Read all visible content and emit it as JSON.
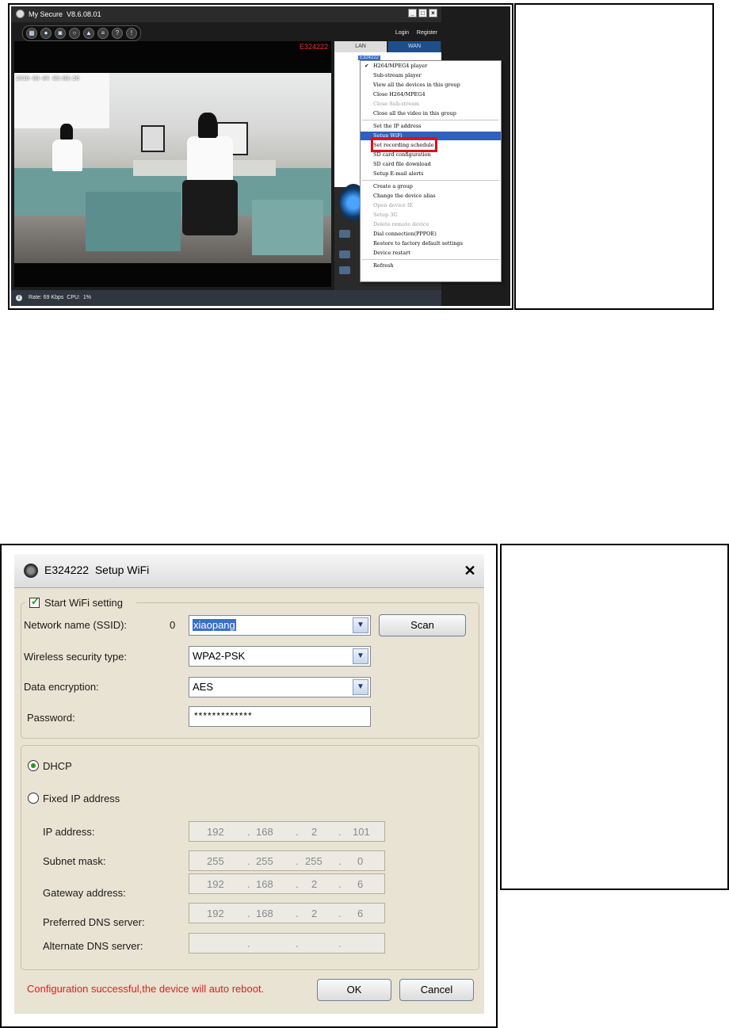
{
  "app": {
    "title": "My Secure",
    "version": "V8.6.08.01",
    "login_label": "Login",
    "register_label": "Register",
    "device_id": "E324222",
    "timestamp": "2016-08-04 09:08:26",
    "tabs": {
      "lan": "LAN",
      "wan": "WAN"
    },
    "tree_node": "E324222",
    "status": {
      "rate": "Rate: 69 Kbps",
      "cpu": "CPU:",
      "cpu_value": "1%"
    },
    "toolbar_icons": [
      "layout-icon",
      "record-icon",
      "camera-icon",
      "search-icon",
      "lock-icon",
      "list-icon",
      "help-icon",
      "info-icon"
    ]
  },
  "context_menu": {
    "items": [
      {
        "label": "H264/MPEG4 player",
        "checked": true,
        "disabled": false
      },
      {
        "label": "Sub-stream player",
        "disabled": false
      },
      {
        "label": "View all the devices in this group",
        "disabled": false
      },
      {
        "label": "Close H264/MPEG4",
        "disabled": false
      },
      {
        "label": "Close Sub-stream",
        "disabled": true
      },
      {
        "label": "Close all the video in this group",
        "disabled": false
      },
      {
        "label": "Set the IP address",
        "disabled": false
      },
      {
        "label": "Setup WiFi",
        "disabled": false,
        "highlighted": true
      },
      {
        "label": "Set recording schedule",
        "disabled": false
      },
      {
        "label": "SD card configuration",
        "disabled": false
      },
      {
        "label": "SD card file download",
        "disabled": false
      },
      {
        "label": "Setup E-mail alerts",
        "disabled": false
      },
      {
        "label": "Create a group",
        "disabled": false
      },
      {
        "label": "Change the device alias",
        "disabled": false
      },
      {
        "label": "Open device IE",
        "disabled": true
      },
      {
        "label": "Setup 3G",
        "disabled": true
      },
      {
        "label": "Delete remote device",
        "disabled": true
      },
      {
        "label": "Dial connection(PPPOE)",
        "disabled": false
      },
      {
        "label": "Restore to factory default settings",
        "disabled": false
      },
      {
        "label": "Device restart",
        "disabled": false
      },
      {
        "label": "Refresh",
        "disabled": false
      }
    ]
  },
  "dialog": {
    "title": "E324222  Setup WiFi",
    "start_wifi_label": "Start WiFi setting",
    "start_wifi_checked": true,
    "ssid_label": "Network name (SSID):",
    "ssid_count": "0",
    "ssid_value": "xiaopang",
    "scan_label": "Scan",
    "security_label": "Wireless security type:",
    "security_value": "WPA2-PSK",
    "encryption_label": "Data encryption:",
    "encryption_value": "AES",
    "password_label": "Password:",
    "password_value": "*************",
    "dhcp_label": "DHCP",
    "dhcp_selected": true,
    "fixed_ip_label": "Fixed IP address",
    "ip_label": "IP address:",
    "ip_value": [
      "192",
      "168",
      "2",
      "101"
    ],
    "subnet_label": "Subnet mask:",
    "subnet_value": [
      "255",
      "255",
      "255",
      "0"
    ],
    "gateway_label": "Gateway address:",
    "gateway_value": [
      "192",
      "168",
      "2",
      "6"
    ],
    "pref_dns_label": "Preferred DNS server:",
    "pref_dns_value": [
      "192",
      "168",
      "2",
      "6"
    ],
    "alt_dns_label": "Alternate DNS server:",
    "alt_dns_value": [
      "",
      "",
      "",
      ""
    ],
    "message": "Configuration successful,the device will auto reboot.",
    "ok_label": "OK",
    "cancel_label": "Cancel"
  },
  "colors": {
    "highlight": "#2f5fbf",
    "annotation_red": "#e01010",
    "error_text": "#e02020",
    "check_green": "#1a9a1a"
  }
}
